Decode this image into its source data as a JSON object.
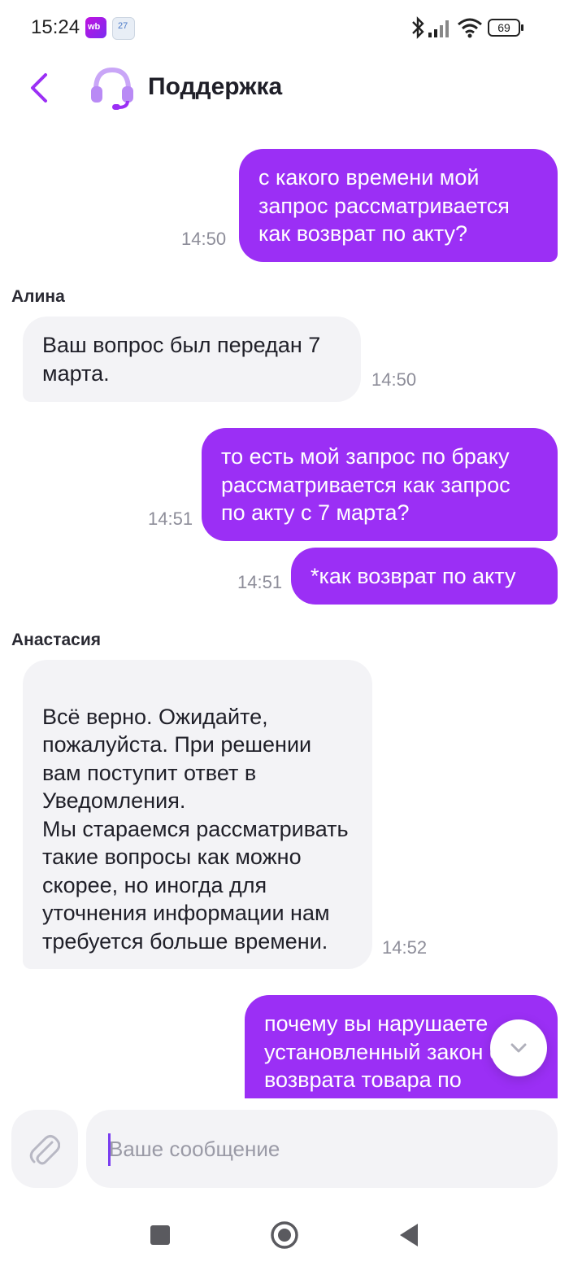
{
  "status_bar": {
    "time": "15:24",
    "app_icon_1": "wb",
    "app_icon_2": "27",
    "battery": "69"
  },
  "header": {
    "title": "Поддержка"
  },
  "messages": [
    {
      "direction": "out",
      "text": "с какого времени мой запрос рассматривается как возврат по акту?",
      "time": "14:50"
    },
    {
      "direction": "in",
      "sender": "Алина",
      "text": "Ваш вопрос был передан 7 марта.",
      "time": "14:50"
    },
    {
      "direction": "out",
      "text": "то есть мой запрос по браку рассматривается как запрос по акту с 7 марта?",
      "time": "14:51"
    },
    {
      "direction": "out",
      "text": "*как возврат по акту",
      "time": "14:51"
    },
    {
      "direction": "in",
      "sender": "Анастасия",
      "text": "Всё верно. Ожидайте, пожалуйста. При решении вам поступит ответ в Уведомления.\nМы стараемся рассматривать такие вопросы как можно скорее, но иногда для уточнения информации нам требуется больше времени.",
      "time": "14:52"
    },
    {
      "direction": "out",
      "text": "почему вы нарушаете установленный закон срок возврата товара по",
      "time": ""
    }
  ],
  "input": {
    "placeholder": "Ваше сообщение",
    "value": ""
  },
  "colors": {
    "accent": "#9b2ff5",
    "incoming_bubble": "#f3f3f6",
    "time_text": "#8d8d99"
  },
  "icons": {
    "back": "chevron-left-icon",
    "avatar": "headset-icon",
    "attach": "paperclip-icon",
    "scroll_down": "chevron-down-icon",
    "nav_recents": "square-icon",
    "nav_home": "circle-icon",
    "nav_back": "triangle-back-icon"
  }
}
